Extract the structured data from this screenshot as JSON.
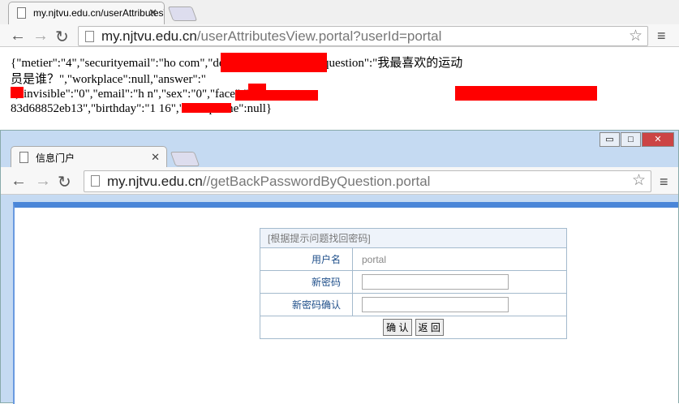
{
  "window1": {
    "tab_title": "my.njtvu.edu.cn/userAttributesView.portal?userId=portal",
    "url_host": "my.njtvu.edu.cn",
    "url_path": "/userAttributesView.portal?userId=portal",
    "json_lines": [
      "{\"metier\":\"4\",\"securityemail\":\"ho                           com\",\"deptname\":\"技术处\",\"question\":\"我最喜欢的运动",
      "员是谁？\",\"workplace\":null,\"answer\":\"",
      "    \",\"invisible\":\"0\",\"email\":\"h                                  n\",\"sex\":\"0\",\"face\":\"5                                         f-",
      "83d68852eb13\",\"birthday\":\"1               16\",\"workphone\":null}"
    ]
  },
  "window2": {
    "tab_title": "信息门户",
    "url_host": "my.njtvu.edu.cn",
    "url_path": "//getBackPasswordByQuestion.portal",
    "form": {
      "header": "[根据提示问题找回密码]",
      "username_label": "用户名",
      "username_value": "portal",
      "new_password_label": "新密码",
      "confirm_password_label": "新密码确认",
      "new_password_value": "",
      "confirm_password_value": "",
      "confirm_button": "确 认",
      "back_button": "返 回"
    }
  },
  "colors": {
    "redaction": "#ff0000",
    "accent": "#4a86d8"
  }
}
